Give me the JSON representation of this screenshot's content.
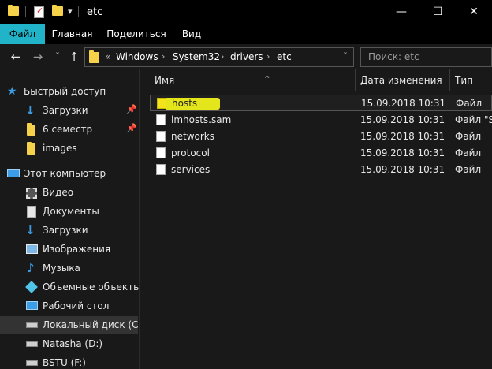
{
  "window": {
    "title": "etc",
    "minimize": "—",
    "maximize": "☐",
    "close": "✕"
  },
  "ribbon": {
    "tabs": [
      "Файл",
      "Главная",
      "Поделиться",
      "Вид"
    ]
  },
  "nav": {
    "back": "←",
    "forward": "→",
    "recent": "˅",
    "up": "↑"
  },
  "address": {
    "overflow": "«",
    "segments": [
      "Windows",
      "System32",
      "drivers",
      "etc"
    ],
    "separator": "›",
    "dropdown": "˅"
  },
  "search": {
    "placeholder": "Поиск: etc"
  },
  "sidebar": {
    "items": [
      {
        "label": "Быстрый доступ",
        "icon": "star-icon"
      },
      {
        "label": "Загрузки",
        "icon": "download-arrow-icon",
        "pinned": true
      },
      {
        "label": "6 семестр",
        "icon": "folder-icon",
        "pinned": true
      },
      {
        "label": "images",
        "icon": "folder-icon"
      },
      {
        "label": "Этот компьютер",
        "icon": "computer-icon"
      },
      {
        "label": "Видео",
        "icon": "video-icon"
      },
      {
        "label": "Документы",
        "icon": "documents-icon"
      },
      {
        "label": "Загрузки",
        "icon": "download-arrow-icon"
      },
      {
        "label": "Изображения",
        "icon": "pictures-icon"
      },
      {
        "label": "Музыка",
        "icon": "music-icon"
      },
      {
        "label": "Объемные объекты",
        "icon": "3d-objects-icon"
      },
      {
        "label": "Рабочий стол",
        "icon": "desktop-icon"
      },
      {
        "label": "Локальный диск (C:)",
        "icon": "drive-icon",
        "selected": true
      },
      {
        "label": "Natasha (D:)",
        "icon": "drive-icon"
      },
      {
        "label": "BSTU (F:)",
        "icon": "drive-icon"
      }
    ]
  },
  "filelist": {
    "columns": [
      "Имя",
      "Дата изменения",
      "Тип"
    ],
    "sort_arrow": "^",
    "rows": [
      {
        "name": "hosts",
        "date": "15.09.2018 10:31",
        "type": "Файл",
        "highlighted": true
      },
      {
        "name": "lmhosts.sam",
        "date": "15.09.2018 10:31",
        "type": "Файл \"SA"
      },
      {
        "name": "networks",
        "date": "15.09.2018 10:31",
        "type": "Файл"
      },
      {
        "name": "protocol",
        "date": "15.09.2018 10:31",
        "type": "Файл"
      },
      {
        "name": "services",
        "date": "15.09.2018 10:31",
        "type": "Файл"
      }
    ]
  },
  "colors": {
    "accent": "#21b3c8",
    "highlight": "#e5e51c",
    "folder": "#f6d24a",
    "blue_icon": "#3c9de6"
  }
}
